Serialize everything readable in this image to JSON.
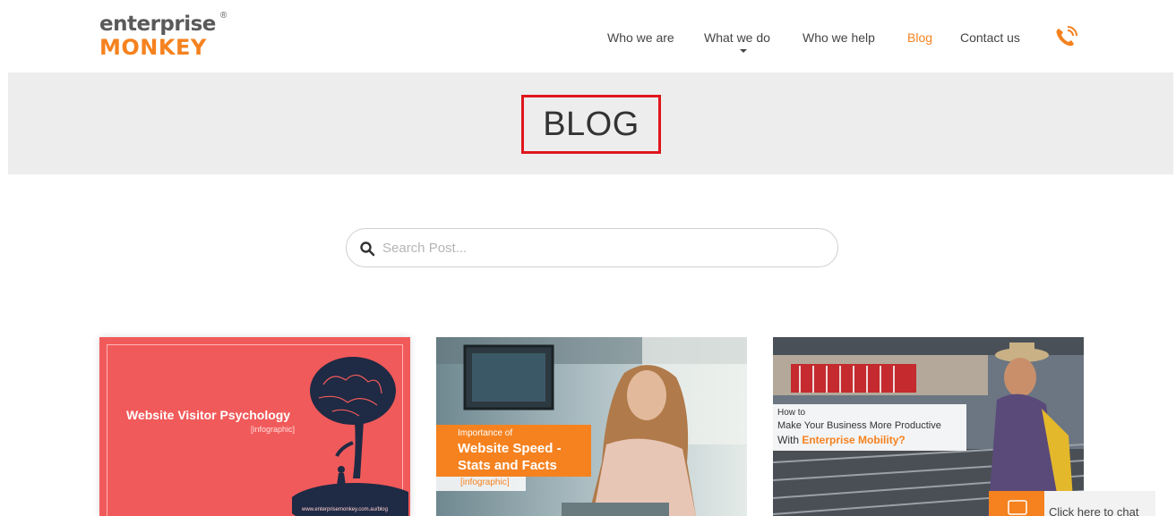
{
  "brand": {
    "logo_top": "enterprise",
    "logo_reg": "®",
    "logo_bottom": "MONKEY"
  },
  "nav": {
    "items": [
      {
        "label": "Who we are"
      },
      {
        "label": "What we do"
      },
      {
        "label": "Who we help"
      },
      {
        "label": "Blog",
        "active": true
      },
      {
        "label": "Contact us"
      }
    ],
    "phone_icon": "phone-icon"
  },
  "banner": {
    "title": "BLOG"
  },
  "search": {
    "placeholder": "Search Post..."
  },
  "cards": [
    {
      "title": "Website Visitor Psychology",
      "subtitle": "[infographic]",
      "footer": "www.enterprisemonkey.com.au/blog"
    },
    {
      "kicker": "Importance of",
      "title_line1": "Website Speed -",
      "title_line2": "Stats and Facts",
      "tag": "[infographic]"
    },
    {
      "line1": "How to",
      "line2": "Make Your Business More Productive",
      "line3_prefix": "With ",
      "line3_highlight": "Enterprise Mobility?"
    }
  ],
  "chat": {
    "label": "Click here to chat"
  },
  "colors": {
    "accent": "#f5821f",
    "highlight_border": "#e0161d",
    "banner_bg": "#ededed",
    "card1_bg": "#f15a5a"
  }
}
